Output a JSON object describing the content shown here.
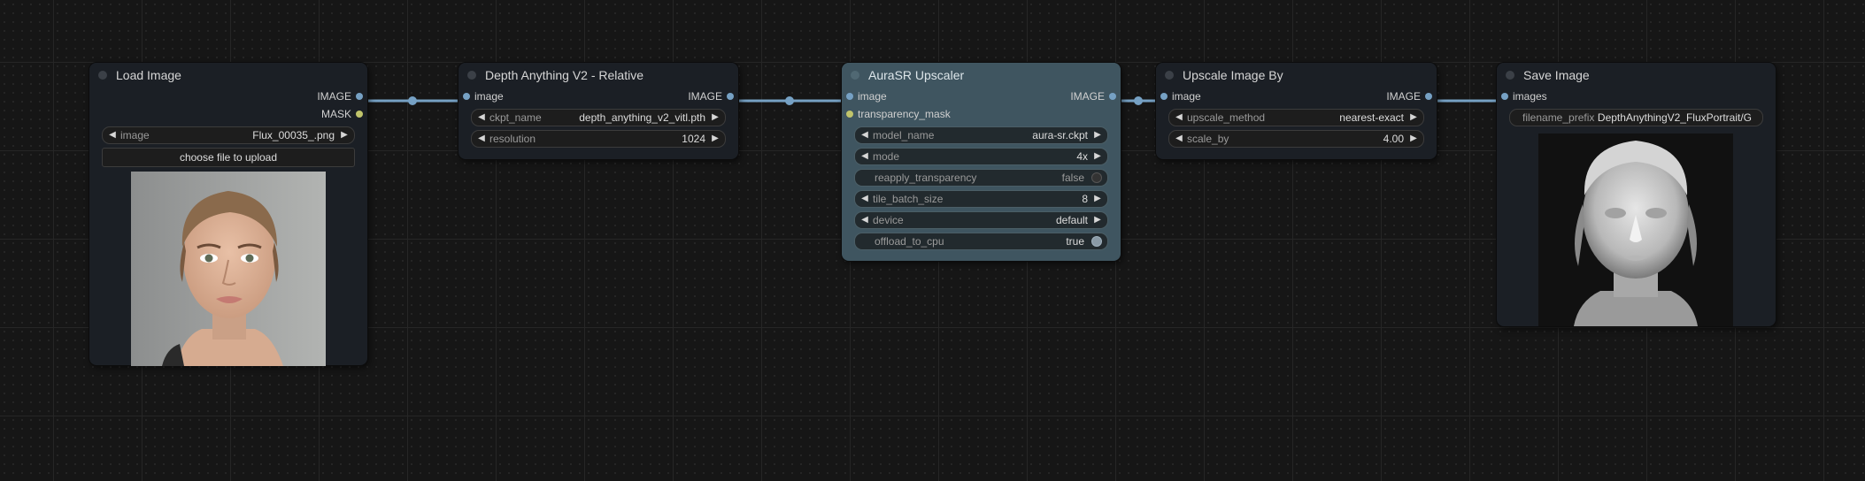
{
  "nodes": {
    "load_image": {
      "title": "Load Image",
      "outputs": [
        "IMAGE",
        "MASK"
      ],
      "image_widget": {
        "name": "image",
        "value": "Flux_00035_.png"
      },
      "upload_button": "choose file to upload",
      "preview": "portrait-photo"
    },
    "depth": {
      "title": "Depth Anything V2 - Relative",
      "input": "image",
      "output": "IMAGE",
      "widgets": [
        {
          "name": "ckpt_name",
          "value": "depth_anything_v2_vitl.pth"
        },
        {
          "name": "resolution",
          "value": "1024"
        }
      ]
    },
    "aurasr": {
      "title": "AuraSR Upscaler",
      "inputs": [
        "image",
        "transparency_mask"
      ],
      "output": "IMAGE",
      "widgets": [
        {
          "name": "model_name",
          "value": "aura-sr.ckpt"
        },
        {
          "name": "mode",
          "value": "4x"
        },
        {
          "name": "reapply_transparency",
          "value": "false"
        },
        {
          "name": "tile_batch_size",
          "value": "8"
        },
        {
          "name": "device",
          "value": "default"
        },
        {
          "name": "offload_to_cpu",
          "value": "true"
        }
      ]
    },
    "upscale": {
      "title": "Upscale Image By",
      "input": "image",
      "output": "IMAGE",
      "widgets": [
        {
          "name": "upscale_method",
          "value": "nearest-exact"
        },
        {
          "name": "scale_by",
          "value": "4.00"
        }
      ]
    },
    "save": {
      "title": "Save Image",
      "input": "images",
      "filename_prefix": {
        "name": "filename_prefix",
        "value": "DepthAnythingV2_FluxPortrait/G"
      },
      "preview": "depth-map"
    }
  },
  "colors": {
    "image_link": "#76a1c4",
    "mask_slot": "#c0c46b",
    "node_bg": "#353a40",
    "node_title_dark": "#1b1f25",
    "node_selected": "#3f5560",
    "canvas_bg": "#161616"
  }
}
